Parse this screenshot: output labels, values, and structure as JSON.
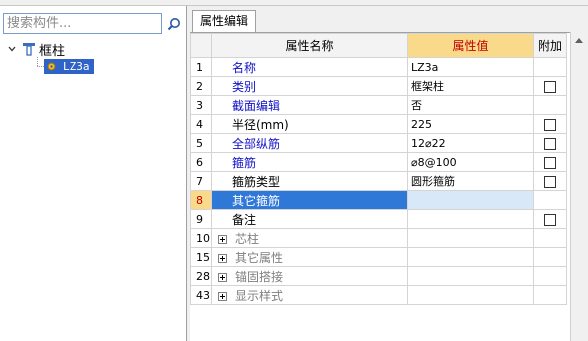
{
  "search": {
    "placeholder": "搜索构件..."
  },
  "tree": {
    "root_label": "框柱",
    "child_label": "LZ3a"
  },
  "tab": {
    "label": "属性编辑"
  },
  "grid": {
    "headers": {
      "name": "属性名称",
      "value": "属性值",
      "extra": "附加"
    },
    "rows": [
      {
        "num": "1",
        "name": "名称",
        "value": "LZ3a",
        "blue": true,
        "checkbox": false
      },
      {
        "num": "2",
        "name": "类别",
        "value": "框架柱",
        "blue": true,
        "checkbox": true
      },
      {
        "num": "3",
        "name": "截面编辑",
        "value": "否",
        "blue": true,
        "checkbox": false
      },
      {
        "num": "4",
        "name": "半径(mm)",
        "value": "225",
        "blue": false,
        "checkbox": true
      },
      {
        "num": "5",
        "name": "全部纵筋",
        "value": "12⌀22",
        "blue": true,
        "checkbox": true
      },
      {
        "num": "6",
        "name": "箍筋",
        "value": "⌀8@100",
        "blue": true,
        "checkbox": true
      },
      {
        "num": "7",
        "name": "箍筋类型",
        "value": "圆形箍筋",
        "blue": false,
        "checkbox": true
      },
      {
        "num": "8",
        "name": "其它箍筋",
        "value": "",
        "blue": false,
        "checkbox": false,
        "selected": true
      },
      {
        "num": "9",
        "name": "备注",
        "value": "",
        "blue": false,
        "checkbox": true
      },
      {
        "num": "10",
        "name": "芯柱",
        "value": "",
        "group": true
      },
      {
        "num": "15",
        "name": "其它属性",
        "value": "",
        "group": true
      },
      {
        "num": "28",
        "name": "锚固搭接",
        "value": "",
        "group": true
      },
      {
        "num": "43",
        "name": "显示样式",
        "value": "",
        "group": true
      }
    ]
  }
}
